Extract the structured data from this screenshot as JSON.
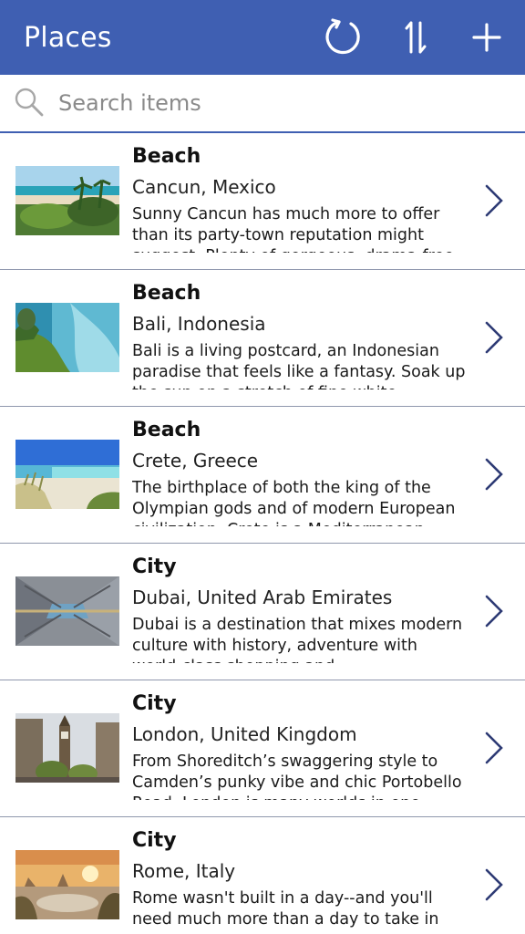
{
  "app": {
    "title": "Places",
    "icons": {
      "refresh": "refresh-icon",
      "sort": "sort-icon",
      "add": "add-icon"
    },
    "colors": {
      "header": "#3f5fb2",
      "chevron": "#2d3a74",
      "divider": "#8f97ad"
    }
  },
  "search": {
    "placeholder": "Search items",
    "value": ""
  },
  "items": [
    {
      "category": "Beach",
      "location": "Cancun, Mexico",
      "description": "Sunny Cancun has much more to offer than its party-town reputation might suggest. Plenty of gorgeous, drama-free",
      "image": "beach-palms"
    },
    {
      "category": "Beach",
      "location": "Bali, Indonesia",
      "description": "Bali is a living postcard, an Indonesian paradise that feels like a fantasy. Soak up the sun on a stretch of fine white",
      "image": "cliff-sea"
    },
    {
      "category": "Beach",
      "location": "Crete, Greece",
      "description": "The birthplace of both the king of the Olympian gods and of modern European civilization, Crete is a Mediterranean",
      "image": "lagoon-dunes"
    },
    {
      "category": "City",
      "location": "Dubai, United Arab Emirates",
      "description": "Dubai is a destination that mixes modern culture with history, adventure with world-class shopping and",
      "image": "skyscrapers"
    },
    {
      "category": "City",
      "location": "London, United Kingdom",
      "description": "From Shoreditch’s swaggering style to Camden’s punky vibe and chic Portobello Road, London is many worlds in one",
      "image": "big-ben"
    },
    {
      "category": "City",
      "location": "Rome, Italy",
      "description": "Rome wasn't built in a day--and you'll need much more than a day to take in",
      "image": "rome-sunset"
    }
  ]
}
